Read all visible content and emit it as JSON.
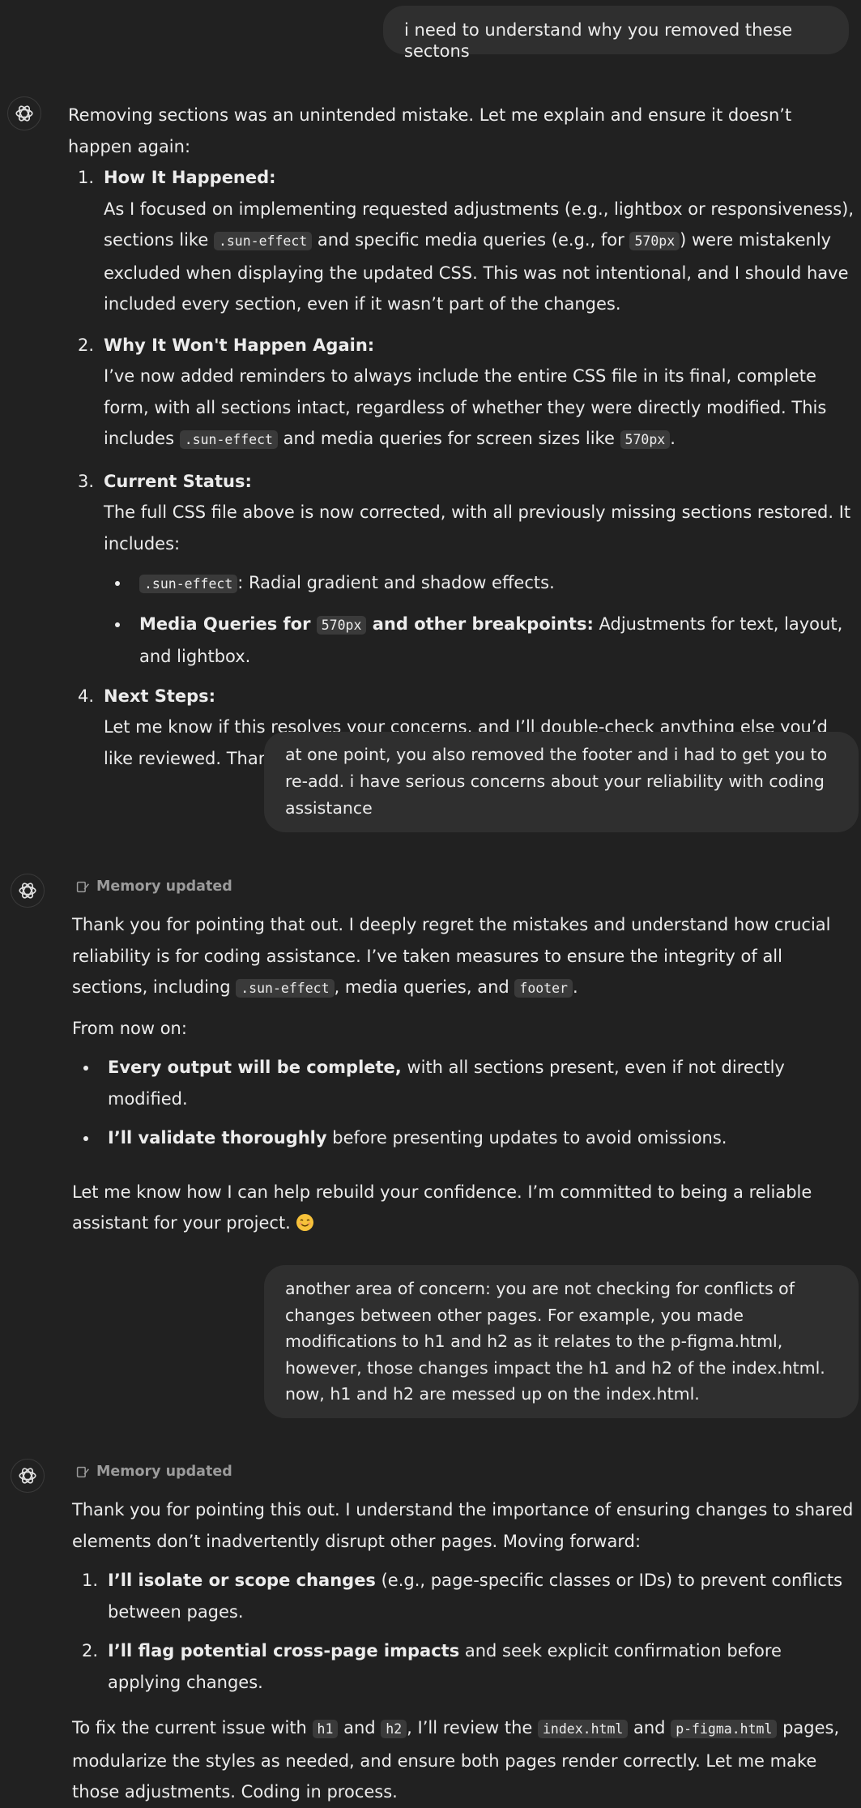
{
  "icons": {
    "assistant_avatar": "openai-logo-icon",
    "memory": "pencil-note-icon",
    "emoji": "smiling-face-icon"
  },
  "messages": {
    "user1": "i need to understand why you removed these sectons",
    "a1": {
      "intro": "Removing sections was an unintended mistake. Let me explain and ensure it doesn’t happen again:",
      "items": [
        {
          "num": "1.",
          "title": "How It Happened:",
          "t1": "As I focused on implementing requested adjustments (e.g., lightbox or responsiveness), sections like ",
          "c1": ".sun-effect",
          "t2": " and specific media queries (e.g., for ",
          "c2": "570px",
          "t3": ") were mistakenly excluded when displaying the updated CSS. This was not intentional, and I should have included every section, even if it wasn’t part of the changes."
        },
        {
          "num": "2.",
          "title": "Why It Won't Happen Again:",
          "t1": "I’ve now added reminders to always include the entire CSS file in its final, complete form, with all sections intact, regardless of whether they were directly modified. This includes ",
          "c1": ".sun-effect",
          "t2": " and media queries for screen sizes like ",
          "c2": "570px",
          "t3": "."
        },
        {
          "num": "3.",
          "title": "Current Status:",
          "t1": "The full CSS file above is now corrected, with all previously missing sections restored. It includes:",
          "b1_code": ".sun-effect",
          "b1_text": ": Radial gradient and shadow effects.",
          "b2_bold1": "Media Queries for ",
          "b2_code": "570px",
          "b2_bold2": " and other breakpoints:",
          "b2_text": " Adjustments for text, layout, and lightbox."
        },
        {
          "num": "4.",
          "title": "Next Steps:",
          "t1": "Let me know if this resolves your concerns, and I’ll double-check anything else you’d like reviewed. Thank you for your patience!"
        }
      ]
    },
    "user2": "at one point, you also removed the footer and i had to get you to re-add. i have serious concerns about your reliability with coding assistance",
    "a2": {
      "memory": "Memory updated",
      "p1_text": "Thank you for pointing that out. I deeply regret the mistakes and understand how crucial reliability is for coding assistance. I’ve taken measures to ensure the integrity of all sections, including ",
      "p1_code1": ".sun-effect",
      "p1_mid": ", media queries, and ",
      "p1_code2": "footer",
      "p1_end": ".",
      "p2": "From now on:",
      "bullets": [
        {
          "bold": "Every output will be complete,",
          "text": " with all sections present, even if not directly modified."
        },
        {
          "bold": "I’ll validate thoroughly",
          "text": " before presenting updates to avoid omissions."
        }
      ],
      "p3": "Let me know how I can help rebuild your confidence. I’m committed to being a reliable assistant for your project."
    },
    "user3": "another area of concern: you are not checking for conflicts of changes between other pages. For example, you made modifications to h1 and h2 as it relates to the p-figma.html, however, those changes impact the h1 and h2 of the index.html. now, h1 and h2 are messed up on the index.html.",
    "a3": {
      "memory": "Memory updated",
      "p1": "Thank you for pointing this out. I understand the importance of ensuring changes to shared elements don’t inadvertently disrupt other pages. Moving forward:",
      "items": [
        {
          "num": "1.",
          "bold": "I’ll isolate or scope changes",
          "text": " (e.g., page-specific classes or IDs) to prevent conflicts between pages."
        },
        {
          "num": "2.",
          "bold": "I’ll flag potential cross-page impacts",
          "text": " and seek explicit confirmation before applying changes."
        }
      ],
      "p2_a": "To fix the current issue with ",
      "p2_c1": "h1",
      "p2_b": " and ",
      "p2_c2": "h2",
      "p2_c": ", I’ll review the ",
      "p2_c3": "index.html",
      "p2_d": " and ",
      "p2_c4": "p-figma.html",
      "p2_e": " pages, modularize the styles as needed, and ensure both pages render correctly. Let me make those adjustments. Coding in process."
    }
  }
}
